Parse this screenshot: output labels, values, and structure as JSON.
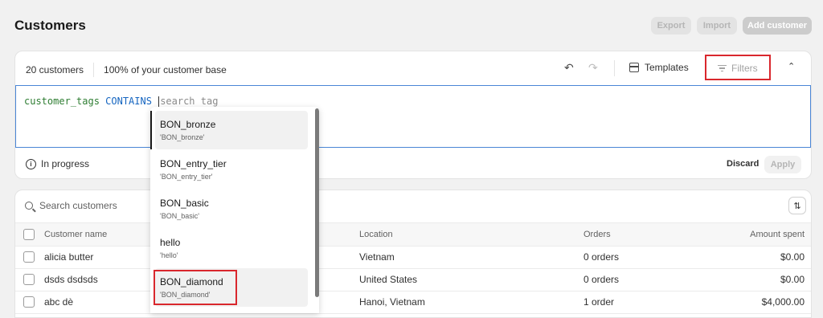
{
  "page": {
    "title": "Customers"
  },
  "header": {
    "export_label": "Export",
    "import_label": "Import",
    "add_label": "Add customer"
  },
  "stats": {
    "count": "20 customers",
    "share": "100% of your customer base"
  },
  "toolbar": {
    "undo_icon": "↶",
    "redo_icon": "↷",
    "templates_label": "Templates",
    "filters_label": "Filters",
    "collapse_icon": "⌃"
  },
  "query": {
    "field": "customer_tags",
    "operator": "CONTAINS",
    "placeholder": "search tag"
  },
  "status": {
    "progress": "In progress",
    "discard": "Discard",
    "apply": "Apply"
  },
  "search": {
    "placeholder": "Search customers",
    "sort_icon": "⇅"
  },
  "table": {
    "columns": [
      "Customer name",
      "Location",
      "Orders",
      "Amount spent"
    ],
    "rows": [
      {
        "name": "alicia butter",
        "location": "Vietnam",
        "orders": "0 orders",
        "amount": "$0.00"
      },
      {
        "name": "dsds dsdsds",
        "location": "United States",
        "orders": "0 orders",
        "amount": "$0.00"
      },
      {
        "name": "abc dè",
        "location": "Hanoi, Vietnam",
        "orders": "1 order",
        "amount": "$4,000.00"
      }
    ]
  },
  "dropdown": {
    "items": [
      {
        "label": "BON_bronze",
        "value": "'BON_bronze'"
      },
      {
        "label": "BON_entry_tier",
        "value": "'BON_entry_tier'"
      },
      {
        "label": "BON_basic",
        "value": "'BON_basic'"
      },
      {
        "label": "hello",
        "value": "'hello'"
      },
      {
        "label": "BON_diamond",
        "value": "'BON_diamond'"
      }
    ]
  },
  "colors": {
    "highlight": "#d9272d",
    "query_border": "#4a86d6",
    "field": "#2e7d32",
    "operator": "#1565c0"
  }
}
